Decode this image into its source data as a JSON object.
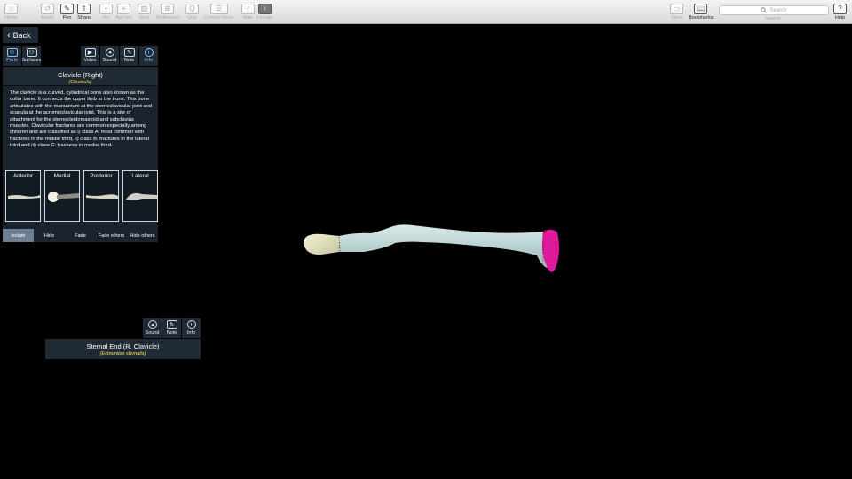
{
  "toolbar": {
    "home": "Home",
    "reset": "Reset",
    "pen": "Pen",
    "share": "Share",
    "pin": "Pin",
    "add_pin": "Add pin",
    "slice": "Slice",
    "multiselect": "Multiselect",
    "quiz": "Quiz",
    "control_menu": "Control Menu",
    "male": "Male",
    "female": "Female",
    "store": "Store",
    "bookmarks": "Bookmarks",
    "search_placeholder": "Search",
    "search_label": "Search",
    "help": "Help"
  },
  "back_label": "Back",
  "side_tabs": {
    "parts": "Parts",
    "surfaces": "Surfaces"
  },
  "info_tabs": {
    "video": "Video",
    "sound": "Sound",
    "note": "Note",
    "info": "Info"
  },
  "panel": {
    "title": "Clavicle (Right)",
    "latin": "(Clavicula)",
    "description": "The clavicle is a curved, cylindrical bone also known as the collar bone. It connects the upper limb to the trunk. This bone articulates with the manubrium at the sternoclavicular joint and scapula at the acromioclavicular joint. This is a site of attachment for the sternocleidomastoid and subclavius muscles. Clavicular fractures are common especially among children and are classified as i) class A: most common with fractures in the middle third, ii) class B: fractures in the lateral third and iii) class C: fractures in medial third.",
    "views": [
      "Anterior",
      "Medial",
      "Posterior",
      "Lateral"
    ],
    "actions": [
      "Isolate",
      "Hide",
      "Fade",
      "Fade others",
      "Hide others"
    ]
  },
  "sub_tabs": {
    "sound": "Sound",
    "note": "Note",
    "info": "Info"
  },
  "sub_panel": {
    "title": "Sternal End (R. Clavicle)",
    "latin": "(Extremitas sternalis)"
  },
  "colors": {
    "bone": "#c8dcdc",
    "highlight": "#e0199a",
    "end": "#e8e6bf"
  }
}
